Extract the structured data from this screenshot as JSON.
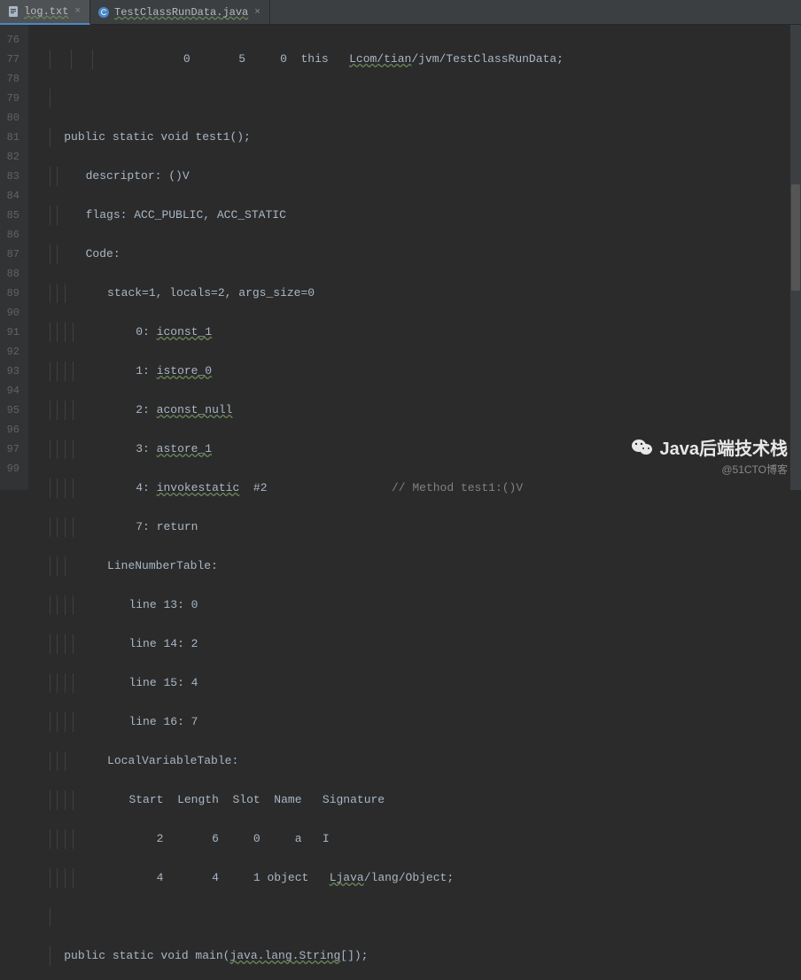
{
  "tabs": [
    {
      "label": "log.txt",
      "icon": "text-file",
      "active": true
    },
    {
      "label": "TestClassRunData.java",
      "icon": "java-class",
      "active": false
    }
  ],
  "gutter_start": 76,
  "gutter_lines": [
    "76",
    "77",
    "78",
    "79",
    "80",
    "81",
    "82",
    "83",
    "84",
    "85",
    "86",
    "87",
    "88",
    "89",
    "90",
    "91",
    "92",
    "93",
    "94",
    "95",
    "96",
    "97",
    "",
    "99"
  ],
  "code": {
    "l76_prefix": "            0       5     0  this   ",
    "l76_link": "Lcom/tian",
    "l76_suffix": "/jvm/TestClassRunData;",
    "l78": "  public static void test1();",
    "l79": "    descriptor: ()V",
    "l80": "    flags: ACC_PUBLIC, ACC_STATIC",
    "l81": "    Code:",
    "l82": "      stack=1, locals=2, args_size=0",
    "l83_pre": "         0: ",
    "l83_inst": "iconst_1",
    "l84_pre": "         1: ",
    "l84_inst": "istore_0",
    "l85_pre": "         2: ",
    "l85_inst": "aconst_null",
    "l86_pre": "         3: ",
    "l86_inst": "astore_1",
    "l87_pre": "         4: ",
    "l87_inst": "invokestatic",
    "l87_mid": "  #2                  ",
    "l87_comment": "// Method test1:()V",
    "l88": "         7: return",
    "l89": "      LineNumberTable:",
    "l90": "        line 13: 0",
    "l91": "        line 14: 2",
    "l92": "        line 15: 4",
    "l93": "        line 16: 7",
    "l94": "      LocalVariableTable:",
    "l95": "        Start  Length  Slot  Name   Signature",
    "l96": "            2       6     0     a   I",
    "l97_pre": "            4       4     1 object   ",
    "l97_link": "Ljava",
    "l97_suffix": "/lang/Object;",
    "l99_pre": "  public static void main(",
    "l99_link": "java.lang.String",
    "l99_suffix": "[]);"
  },
  "watermark": {
    "main": "Java后端技术栈",
    "sub": "@51CTO博客"
  }
}
